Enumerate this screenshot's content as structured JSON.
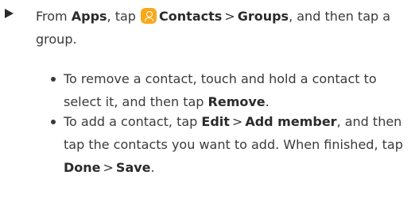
{
  "step": {
    "prefix": "From ",
    "apps": "Apps",
    "tap": ", tap ",
    "contacts": "Contacts",
    "sep1": ">",
    "groups": "Groups",
    "suffix": ", and then tap a group.",
    "icon": "contacts-app-icon",
    "icon_color": "#f7a91c"
  },
  "bullets": [
    {
      "pre": "To remove a contact, touch and hold a contact to select it, and then tap ",
      "bold1": "Remove",
      "post": "."
    },
    {
      "pre": "To add a contact, tap ",
      "bold1": "Edit",
      "sep": ">",
      "bold2": "Add member",
      "mid": ", and then tap the contacts you want to add. When finished, tap ",
      "bold3": "Done",
      "sep2": ">",
      "bold4": "Save",
      "post": "."
    }
  ]
}
